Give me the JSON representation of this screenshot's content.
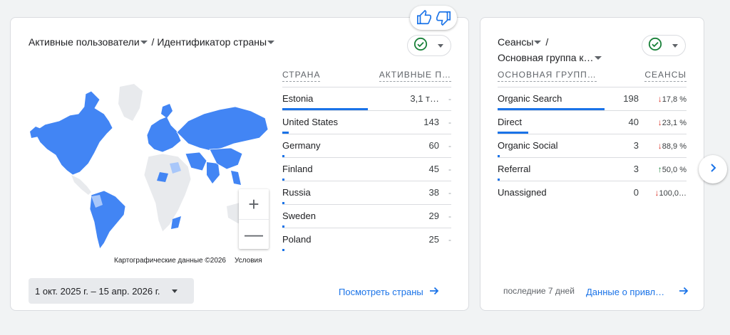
{
  "feedback": {
    "like_icon": "thumb-up-icon",
    "dislike_icon": "thumb-down-icon"
  },
  "left_card": {
    "title_metric": "Активные пользователи",
    "title_separator": " / ",
    "title_dimension": "Идентификатор страны",
    "status_icon": "check-circle-icon",
    "table": {
      "headers": [
        "СТРАНА",
        "АКТИВНЫЕ П…"
      ],
      "rows": [
        {
          "country": "Estonia",
          "value": "3,1 т…",
          "change": "-",
          "share": 1.0
        },
        {
          "country": "United States",
          "value": "143",
          "change": "-",
          "share": 0.046
        },
        {
          "country": "Germany",
          "value": "60",
          "change": "-",
          "share": 0.02
        },
        {
          "country": "Finland",
          "value": "45",
          "change": "-",
          "share": 0.015
        },
        {
          "country": "Russia",
          "value": "38",
          "change": "-",
          "share": 0.012
        },
        {
          "country": "Sweden",
          "value": "29",
          "change": "-",
          "share": 0.01
        },
        {
          "country": "Poland",
          "value": "25",
          "change": "-",
          "share": 0.008
        }
      ]
    },
    "map": {
      "zoom_in": "+",
      "zoom_out": "—",
      "credit": "Картографические данные ©2026",
      "terms": "Условия",
      "highlight_color": "#4285f4",
      "light_color": "#a8c7fa",
      "land_color": "#e8eaed"
    },
    "date_range": "1 окт. 2025 г. – 15 апр. 2026 г.",
    "view_link": "Посмотреть страны"
  },
  "right_card": {
    "title_metric": "Сеансы",
    "title_separator": " /",
    "title_dimension": "Основная группа к…",
    "status_icon": "check-circle-icon",
    "table": {
      "headers": [
        "ОСНОВНАЯ ГРУПП…",
        "СЕАНСЫ"
      ],
      "rows": [
        {
          "channel": "Organic Search",
          "value": "198",
          "change": "17,8 %",
          "direction": "down",
          "share": 1.0
        },
        {
          "channel": "Direct",
          "value": "40",
          "change": "23,1 %",
          "direction": "down",
          "share": 0.2
        },
        {
          "channel": "Organic Social",
          "value": "3",
          "change": "88,9 %",
          "direction": "down",
          "share": 0.015
        },
        {
          "channel": "Referral",
          "value": "3",
          "change": "50,0 %",
          "direction": "up",
          "share": 0.015
        },
        {
          "channel": "Unassigned",
          "value": "0",
          "change": "100,0…",
          "direction": "down",
          "share": 0
        }
      ]
    },
    "period": "последние 7 дней",
    "view_link": "Данные о привл…"
  },
  "accent_color": "#1a73e8"
}
